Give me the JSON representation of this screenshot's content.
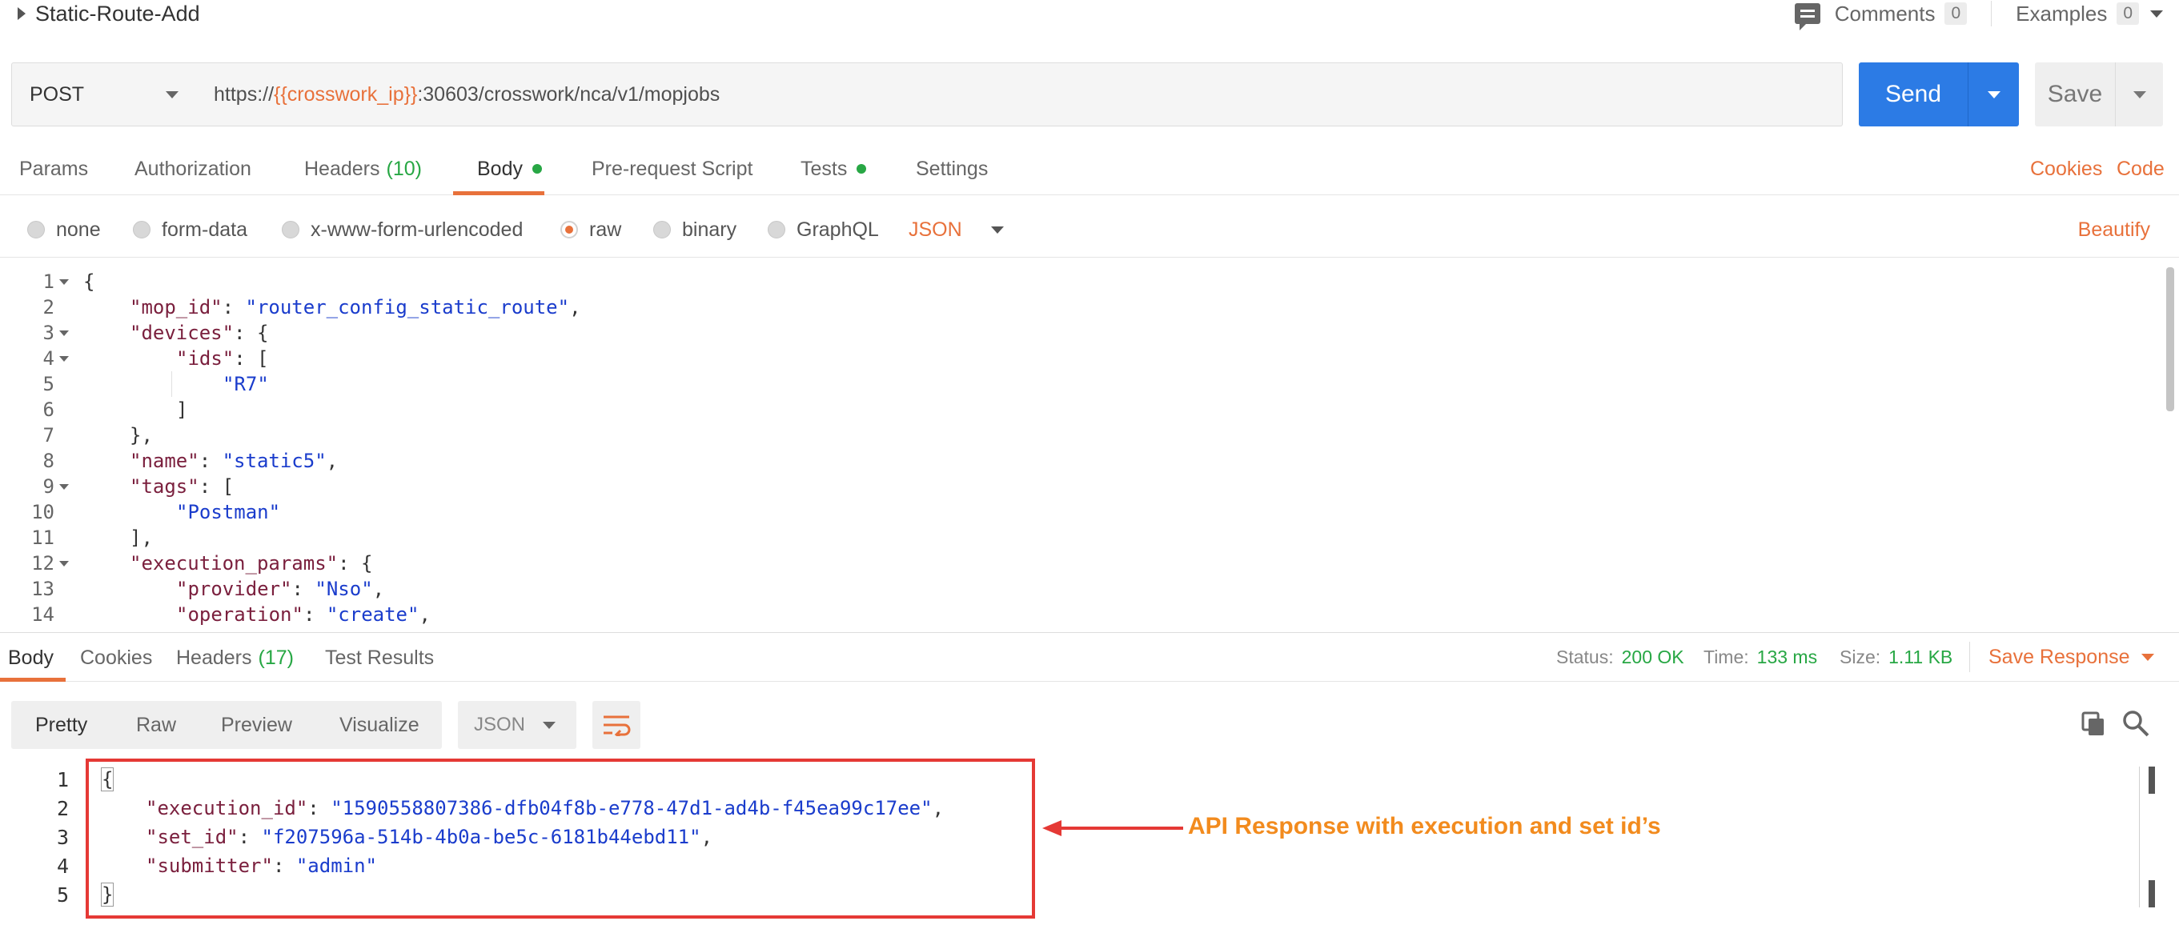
{
  "request": {
    "name": "Static-Route-Add",
    "comments_label": "Comments",
    "comments_count": "0",
    "examples_label": "Examples",
    "examples_count": "0",
    "method": "POST",
    "url_prefix": "https://",
    "url_var": "{{crosswork_ip}}",
    "url_suffix": ":30603/crosswork/nca/v1/mopjobs",
    "send_label": "Send",
    "save_label": "Save"
  },
  "request_tabs": {
    "params": "Params",
    "authorization": "Authorization",
    "headers": "Headers",
    "headers_count": "(10)",
    "body": "Body",
    "prerequest": "Pre-request Script",
    "tests": "Tests",
    "settings": "Settings",
    "cookies": "Cookies",
    "code": "Code"
  },
  "body_types": {
    "none": "none",
    "form_data": "form-data",
    "urlencoded": "x-www-form-urlencoded",
    "raw": "raw",
    "binary": "binary",
    "graphql": "GraphQL",
    "format": "JSON",
    "beautify": "Beautify",
    "selected": "raw"
  },
  "request_body_lines": [
    {
      "n": "1",
      "fold": true,
      "indent": 0,
      "text": "{"
    },
    {
      "n": "2",
      "fold": false,
      "indent": 1,
      "key": "\"mop_id\"",
      "sep": ": ",
      "str": "\"router_config_static_route\"",
      "tail": ","
    },
    {
      "n": "3",
      "fold": true,
      "indent": 1,
      "key": "\"devices\"",
      "sep": ": {"
    },
    {
      "n": "4",
      "fold": true,
      "indent": 2,
      "key": "\"ids\"",
      "sep": ": ["
    },
    {
      "n": "5",
      "fold": false,
      "indent": 3,
      "str": "\"R7\""
    },
    {
      "n": "6",
      "fold": false,
      "indent": 2,
      "text": "]"
    },
    {
      "n": "7",
      "fold": false,
      "indent": 1,
      "text": "},"
    },
    {
      "n": "8",
      "fold": false,
      "indent": 1,
      "key": "\"name\"",
      "sep": ": ",
      "str": "\"static5\"",
      "tail": ","
    },
    {
      "n": "9",
      "fold": true,
      "indent": 1,
      "key": "\"tags\"",
      "sep": ": ["
    },
    {
      "n": "10",
      "fold": false,
      "indent": 2,
      "str": "\"Postman\""
    },
    {
      "n": "11",
      "fold": false,
      "indent": 1,
      "text": "],"
    },
    {
      "n": "12",
      "fold": true,
      "indent": 1,
      "key": "\"execution_params\"",
      "sep": ": {"
    },
    {
      "n": "13",
      "fold": false,
      "indent": 2,
      "key": "\"provider\"",
      "sep": ": ",
      "str": "\"Nso\"",
      "tail": ","
    },
    {
      "n": "14",
      "fold": false,
      "indent": 2,
      "key": "\"operation\"",
      "sep": ": ",
      "str": "\"create\"",
      "tail": ","
    }
  ],
  "response_tabs": {
    "body": "Body",
    "cookies": "Cookies",
    "headers": "Headers",
    "headers_count": "(17)",
    "test_results": "Test Results",
    "status_label": "Status:",
    "status_value": "200 OK",
    "time_label": "Time:",
    "time_value": "133 ms",
    "size_label": "Size:",
    "size_value": "1.11 KB",
    "save_response": "Save Response"
  },
  "response_toolbar": {
    "pretty": "Pretty",
    "raw": "Raw",
    "preview": "Preview",
    "visualize": "Visualize",
    "format": "JSON"
  },
  "response_body_lines": [
    {
      "n": "1",
      "text": "{"
    },
    {
      "n": "2",
      "key": "\"execution_id\"",
      "sep": ": ",
      "str": "\"1590558807386-dfb04f8b-e778-47d1-ad4b-f45ea99c17ee\"",
      "tail": ","
    },
    {
      "n": "3",
      "key": "\"set_id\"",
      "sep": ": ",
      "str": "\"f207596a-514b-4b0a-be5c-6181b44ebd11\"",
      "tail": ","
    },
    {
      "n": "4",
      "key": "\"submitter\"",
      "sep": ": ",
      "str": "\"admin\""
    },
    {
      "n": "5",
      "text": "}"
    }
  ],
  "annotation": {
    "text": "API Response with execution and set id’s",
    "color": "#f28b1e",
    "box_color": "#e53935"
  },
  "colors": {
    "accent": "#e8713b",
    "send": "#2c7be5",
    "status_ok": "#27a744"
  }
}
